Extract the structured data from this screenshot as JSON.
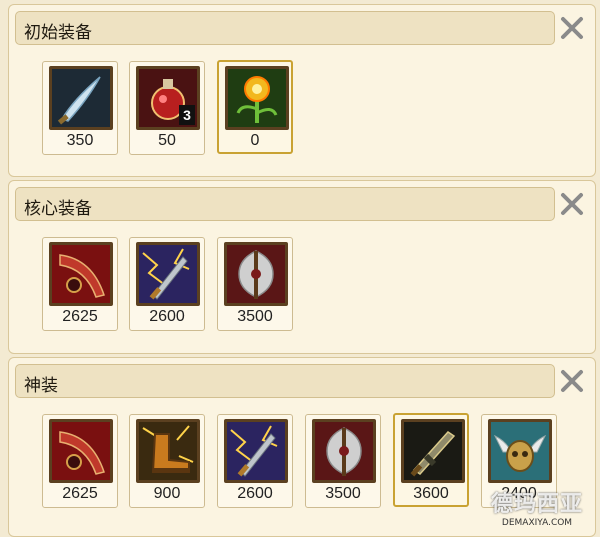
{
  "sections": [
    {
      "title": "初始装备",
      "items": [
        {
          "icon": "curved-sword-icon",
          "price": "350"
        },
        {
          "icon": "health-potion-icon",
          "price": "50",
          "badge": "3"
        },
        {
          "icon": "golden-flower-totem-icon",
          "price": "0",
          "selected": true
        }
      ]
    },
    {
      "title": "核心装备",
      "items": [
        {
          "icon": "red-scythe-blade-icon",
          "price": "2625"
        },
        {
          "icon": "lightning-sword-icon",
          "price": "2600"
        },
        {
          "icon": "silver-axe-icon",
          "price": "3500"
        }
      ]
    },
    {
      "title": "神装",
      "items": [
        {
          "icon": "red-scythe-blade-icon",
          "price": "2625"
        },
        {
          "icon": "golden-boots-icon",
          "price": "900"
        },
        {
          "icon": "lightning-sword-icon",
          "price": "2600"
        },
        {
          "icon": "silver-axe-icon",
          "price": "3500"
        },
        {
          "icon": "dark-greatsword-icon",
          "price": "3600",
          "selected": true
        },
        {
          "icon": "winged-helm-icon",
          "price": "2400"
        }
      ]
    }
  ],
  "watermark": {
    "main": "德玛西亚",
    "sub": "DEMAXIYA.COM"
  },
  "close_icon": "close-x-icon"
}
